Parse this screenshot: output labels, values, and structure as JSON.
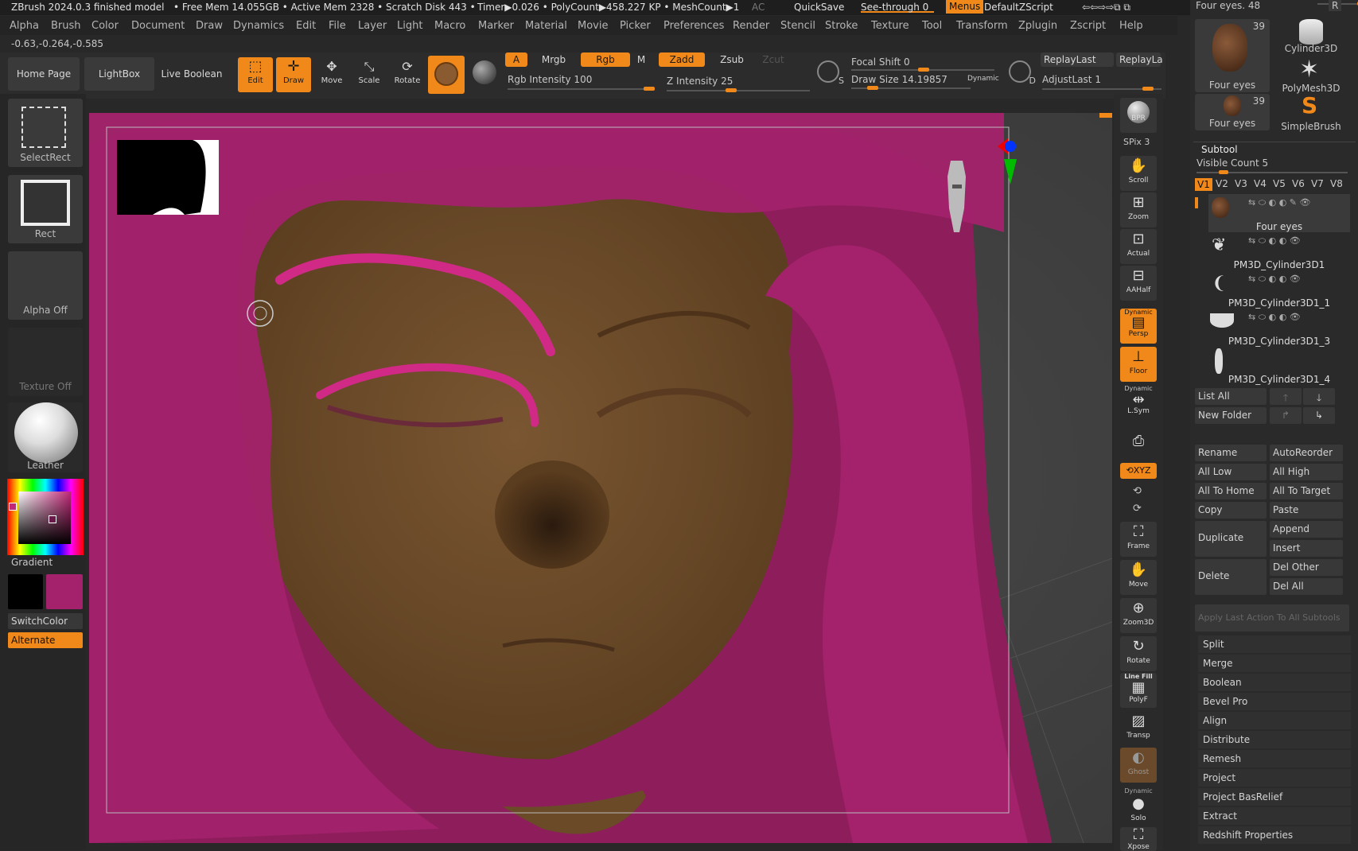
{
  "app": {
    "title": "ZBrush 2024.0.3 finished model",
    "stats": "• Free Mem 14.055GB • Active Mem 2328 • Scratch Disk 443 •",
    "timer": "Timer▶0.026 • PolyCount▶458.227 KP • MeshCount▶1",
    "ac": "AC",
    "quicksave": "QuickSave",
    "see_through": "See-through  0",
    "menus_toggle": "Menus",
    "script": "DefaultZScript"
  },
  "menu": [
    "Alpha",
    "Brush",
    "Color",
    "Document",
    "Draw",
    "Dynamics",
    "Edit",
    "File",
    "Layer",
    "Light",
    "Macro",
    "Marker",
    "Material",
    "Movie",
    "Picker",
    "Preferences",
    "Render",
    "Stencil",
    "Stroke",
    "Texture",
    "Tool",
    "Transform",
    "Zplugin",
    "Zscript",
    "Help"
  ],
  "coords": "-0.63,-0.264,-0.585",
  "toolbar": {
    "home": "Home Page",
    "lightbox": "LightBox",
    "live_boolean": "Live Boolean",
    "edit": "Edit",
    "draw": "Draw",
    "move": "Move",
    "scale": "Scale",
    "rotate": "Rotate",
    "a": "A",
    "mrgb": "Mrgb",
    "rgb": "Rgb",
    "m": "M",
    "zadd": "Zadd",
    "zsub": "Zsub",
    "zcut": "Zcut",
    "rgb_intensity": "Rgb Intensity 100",
    "z_intensity": "Z Intensity 25",
    "focal_shift": "Focal Shift 0",
    "draw_size": "Draw Size 14.19857",
    "dynamic": "Dynamic",
    "replay_last": "ReplayLast",
    "replay_la": "ReplayLa",
    "adjust_last": "AdjustLast 1",
    "s": "S",
    "d": "D"
  },
  "left": {
    "select_rect": "SelectRect",
    "rect": "Rect",
    "alpha_off": "Alpha Off",
    "texture_off": "Texture Off",
    "material": "Leather",
    "gradient": "Gradient",
    "switch_color": "SwitchColor",
    "alternate": "Alternate",
    "primary_color": "#000000",
    "secondary_color": "#a3226b"
  },
  "right_tools": {
    "bpr": "BPR",
    "spix": "SPix 3",
    "scroll": "Scroll",
    "zoom": "Zoom",
    "actual": "Actual",
    "aahalf": "AAHalf",
    "dynamic": "Dynamic",
    "persp": "Persp",
    "floor": "Floor",
    "lsym": "L.Sym",
    "xyz": "⟲XYZ",
    "frame": "Frame",
    "move": "Move",
    "zoom3d": "Zoom3D",
    "rotate": "Rotate",
    "line_fill": "Line Fill",
    "polyf": "PolyF",
    "transp": "Transp",
    "ghost": "Ghost",
    "solo": "Solo",
    "xpose": "Xpose"
  },
  "tray": {
    "tool_name": "Four eyes. 48",
    "r": "R",
    "tools": [
      {
        "label": "Four eyes",
        "count": "39"
      },
      {
        "label": "Cylinder3D"
      },
      {
        "label": "PolyMesh3D"
      },
      {
        "label": "Four eyes",
        "count": "39"
      },
      {
        "label": "SimpleBrush"
      }
    ],
    "subtool_title": "Subtool",
    "visible_count": "Visible Count 5",
    "versions": [
      "V1",
      "V2",
      "V3",
      "V4",
      "V5",
      "V6",
      "V7",
      "V8"
    ],
    "subtools": [
      "Four eyes",
      "PM3D_Cylinder3D1",
      "PM3D_Cylinder3D1_1",
      "PM3D_Cylinder3D1_3",
      "PM3D_Cylinder3D1_4"
    ],
    "list_all": "List All",
    "new_folder": "New Folder",
    "rename": "Rename",
    "auto_reorder": "AutoReorder",
    "all_low": "All Low",
    "all_high": "All High",
    "all_to_home": "All To Home",
    "all_to_target": "All To Target",
    "copy": "Copy",
    "paste": "Paste",
    "duplicate": "Duplicate",
    "append": "Append",
    "insert": "Insert",
    "delete": "Delete",
    "del_other": "Del Other",
    "del_all": "Del All",
    "apply_last": "Apply Last Action To All Subtools",
    "menu_items": [
      "Split",
      "Merge",
      "Boolean",
      "Bevel Pro",
      "Align",
      "Distribute",
      "Remesh",
      "Project",
      "Project BasRelief",
      "Extract",
      "Redshift Properties"
    ]
  },
  "colors": {
    "accent": "#f0891a",
    "hair": "#a3226b",
    "skin": "#6b4a28"
  }
}
